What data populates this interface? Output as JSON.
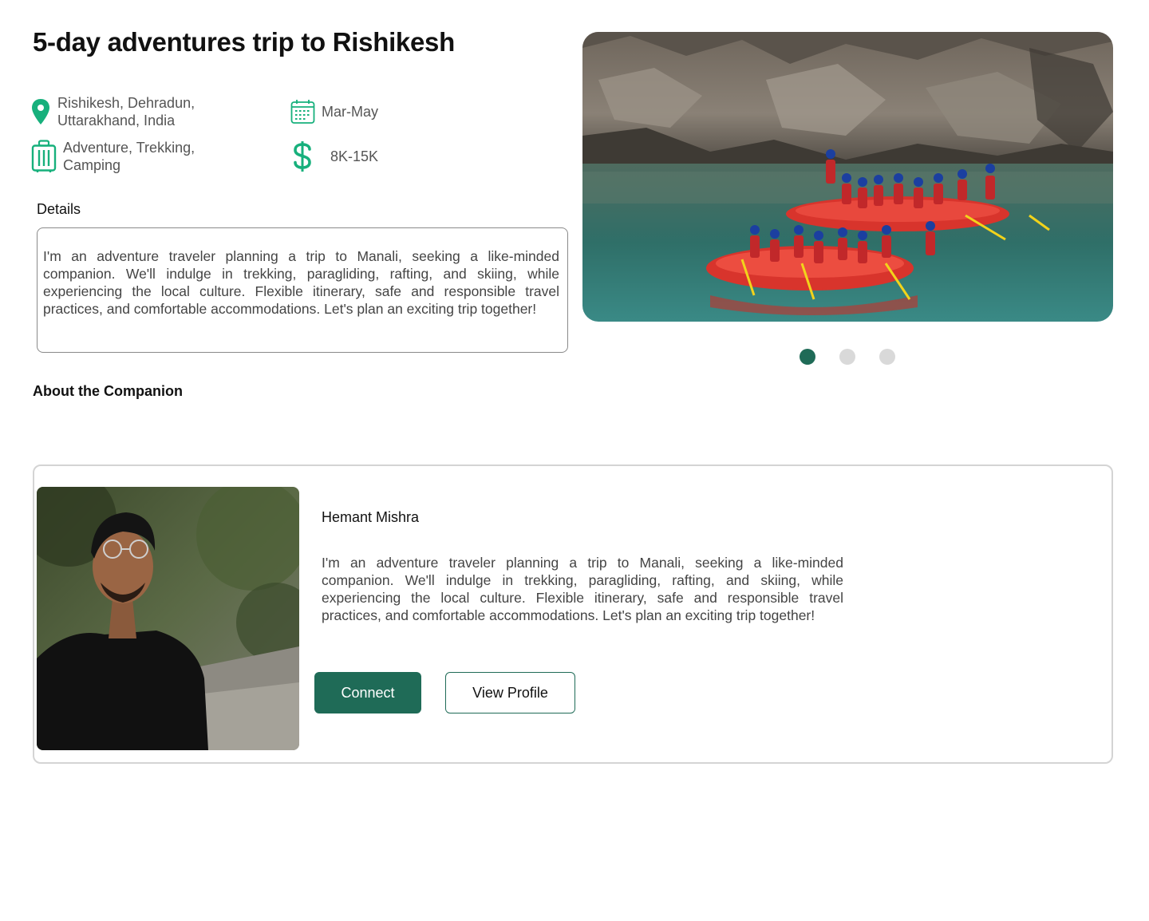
{
  "trip": {
    "title": "5-day adventures trip to Rishikesh",
    "location_line1": "Rishikesh, Dehradun,",
    "location_line2": "Uttarakhand, India",
    "dates": "Mar-May",
    "tags_line1": "Adventure, Trekking,",
    "tags_line2": "Camping",
    "budget": "8K-15K"
  },
  "details": {
    "label": "Details",
    "text": "I'm an adventure traveler planning a trip to Manali, seeking a like-minded companion. We'll indulge in trekking, paragliding, rafting, and skiing, while experiencing the local culture. Flexible itinerary, safe and responsible travel practices, and comfortable accommodations. Let's plan an exciting trip together!"
  },
  "carousel": {
    "active_index": 0,
    "count": 3
  },
  "about": {
    "heading": "About the Companion"
  },
  "companion": {
    "name": "Hemant Mishra",
    "bio": "I'm an adventure traveler planning a trip to Manali, seeking a like-minded companion. We'll indulge in trekking, paragliding, rafting, and skiing, while experiencing the local culture. Flexible itinerary, safe and responsible travel practices, and comfortable accommodations. Let's plan an exciting trip together!",
    "connect_label": "Connect",
    "view_profile_label": "View Profile"
  },
  "icons": {
    "location": "map-pin-icon",
    "dates": "calendar-icon",
    "tags": "luggage-icon",
    "budget": "dollar-icon"
  },
  "colors": {
    "accent": "#1f6b57",
    "icon_green": "#17b07c",
    "dot_inactive": "#d9d9d9"
  }
}
